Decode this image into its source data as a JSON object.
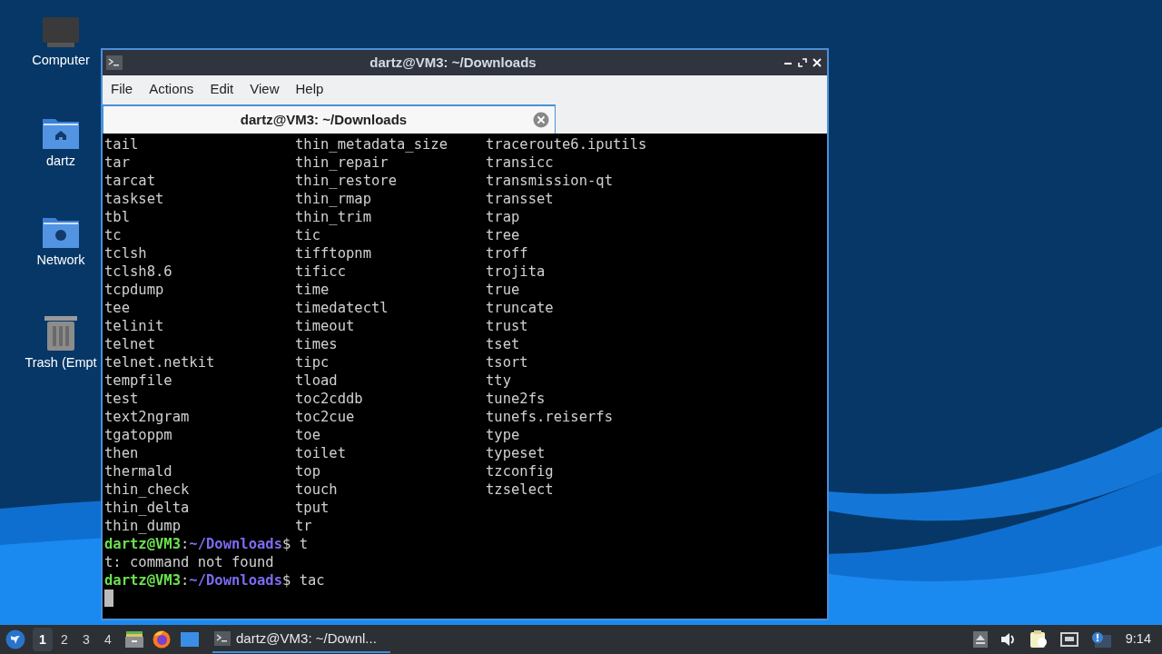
{
  "desktop_icons": [
    {
      "kind": "computer",
      "label": "Computer"
    },
    {
      "kind": "home",
      "label": "dartz"
    },
    {
      "kind": "network",
      "label": "Network"
    },
    {
      "kind": "trash",
      "label": "Trash (Empt"
    }
  ],
  "window": {
    "title": "dartz@VM3: ~/Downloads",
    "menu": [
      "File",
      "Actions",
      "Edit",
      "View",
      "Help"
    ],
    "tabs": [
      {
        "label": "dartz@VM3: ~/Downloads",
        "selected": true
      }
    ],
    "terminal": {
      "listing": [
        [
          "tail",
          "thin_metadata_size",
          "traceroute6.iputils"
        ],
        [
          "tar",
          "thin_repair",
          "transicc"
        ],
        [
          "tarcat",
          "thin_restore",
          "transmission-qt"
        ],
        [
          "taskset",
          "thin_rmap",
          "transset"
        ],
        [
          "tbl",
          "thin_trim",
          "trap"
        ],
        [
          "tc",
          "tic",
          "tree"
        ],
        [
          "tclsh",
          "tifftopnm",
          "troff"
        ],
        [
          "tclsh8.6",
          "tificc",
          "trojita"
        ],
        [
          "tcpdump",
          "time",
          "true"
        ],
        [
          "tee",
          "timedatectl",
          "truncate"
        ],
        [
          "telinit",
          "timeout",
          "trust"
        ],
        [
          "telnet",
          "times",
          "tset"
        ],
        [
          "telnet.netkit",
          "tipc",
          "tsort"
        ],
        [
          "tempfile",
          "tload",
          "tty"
        ],
        [
          "test",
          "toc2cddb",
          "tune2fs"
        ],
        [
          "text2ngram",
          "toc2cue",
          "tunefs.reiserfs"
        ],
        [
          "tgatoppm",
          "toe",
          "type"
        ],
        [
          "then",
          "toilet",
          "typeset"
        ],
        [
          "thermald",
          "top",
          "tzconfig"
        ],
        [
          "thin_check",
          "touch",
          "tzselect"
        ],
        [
          "thin_delta",
          "tput"
        ],
        [
          "thin_dump",
          "tr"
        ]
      ],
      "lines": [
        {
          "kind": "prompt",
          "user": "dartz@VM3",
          "sep": ":",
          "path": "~/Downloads",
          "symbol": "$",
          "command": "t"
        },
        {
          "kind": "output",
          "text": "t: command not found"
        },
        {
          "kind": "prompt",
          "user": "dartz@VM3",
          "sep": ":",
          "path": "~/Downloads",
          "symbol": "$",
          "command": "tac"
        }
      ],
      "cursor": true
    }
  },
  "taskbar": {
    "workspaces": [
      {
        "label": "1",
        "selected": true
      },
      {
        "label": "2",
        "selected": false
      },
      {
        "label": "3",
        "selected": false
      },
      {
        "label": "4",
        "selected": false
      }
    ],
    "launchers": [
      {
        "kind": "files"
      },
      {
        "kind": "browser"
      },
      {
        "kind": "desktop"
      }
    ],
    "tasks": [
      {
        "title": "dartz@VM3: ~/Downl...",
        "selected": true
      }
    ],
    "tray": [
      {
        "kind": "eject"
      },
      {
        "kind": "volume"
      },
      {
        "kind": "clipboard"
      },
      {
        "kind": "network"
      },
      {
        "kind": "notification"
      }
    ],
    "clock": "9:14"
  }
}
